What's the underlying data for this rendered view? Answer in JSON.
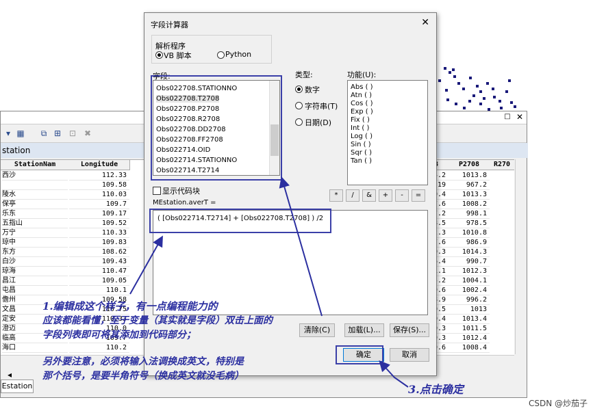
{
  "attr_window": {
    "tab_title": "station",
    "bottom_tab": "Estation",
    "columns": [
      "StationNam",
      "Longitude",
      "8",
      "P2708",
      "R270"
    ],
    "station_names": [
      "西沙",
      "",
      "陵水",
      "保亭",
      "乐东",
      "五指山",
      "万宁",
      "琼中",
      "东方",
      "白沙",
      "琼海",
      "昌江",
      "屯昌",
      "儋州",
      "文昌",
      "定安",
      "澄迈",
      "临高",
      "海口"
    ],
    "longitudes": [
      "112.33",
      "109.58",
      "110.03",
      "109.7",
      "109.17",
      "109.52",
      "110.33",
      "109.83",
      "108.62",
      "109.43",
      "110.47",
      "109.05",
      "110.1",
      "109.58",
      "110.75",
      "110.33",
      "110.0",
      "109.7",
      "110.2"
    ],
    "col8": [
      "4.2",
      "19",
      "0.4",
      "7.6",
      "7.2",
      "8.5",
      "2.3",
      "7.6",
      "0.3",
      "6.4",
      "1.1",
      "5.2",
      "9.6",
      "8.9",
      "0.5",
      "0.4",
      "0.3",
      "9.3",
      "9.6"
    ],
    "p2708": [
      "1013.8",
      "967.2",
      "1013.3",
      "1008.2",
      "998.1",
      "978.5",
      "1010.8",
      "986.9",
      "1014.3",
      "990.7",
      "1012.3",
      "1004.1",
      "1002.4",
      "996.2",
      "1013",
      "1013.4",
      "1011.5",
      "1012.4",
      "1008.4"
    ]
  },
  "dialog": {
    "title": "字段计算器",
    "close_symbol": "✕",
    "parser_label": "解析程序",
    "parser_options": [
      "VB 脚本",
      "Python"
    ],
    "fields_label": "字段:",
    "fields": [
      "Obs022708.STATIONNO",
      "Obs022708.T2708",
      "Obs022708.P2708",
      "Obs022708.R2708",
      "Obs022708.DD2708",
      "Obs022708.FF2708",
      "Obs022714.OID",
      "Obs022714.STATIONNO",
      "Obs022714.T2714"
    ],
    "type_label": "类型:",
    "types": [
      "数字",
      "字符串(T)",
      "日期(D)"
    ],
    "func_label": "功能(U):",
    "functions": [
      "Abs ( )",
      "Atn ( )",
      "Cos ( )",
      "Exp ( )",
      "Fix ( )",
      "Int ( )",
      "Log ( )",
      "Sin ( )",
      "Sqr ( )",
      "Tan ( )"
    ],
    "show_codeblock": "显示代码块",
    "target_label": "MEstation.averT =",
    "operators": [
      "*",
      "/",
      "&",
      "+",
      "-",
      "="
    ],
    "expression": "( [Obs022714.T2714] + [Obs022708.T2708] ) /2",
    "buttons": {
      "clear": "清除(C)",
      "load": "加载(L)...",
      "save": "保存(S)...",
      "ok": "确定",
      "cancel": "取消"
    }
  },
  "annotations": {
    "line1": "1.编辑成这个样子，有一点编程能力的",
    "line2": "应该都能看懂，至于变量（其实就是字段）双击上面的",
    "line3": "字段列表即可将其添加到代码部分；",
    "line4": "另外要注意，必须将输入法调换成英文，特别是",
    "line5": "那个括号，是要半角符号（换成英文就没毛病）",
    "step3": "3.点击确定"
  },
  "watermark": "CSDN @炒茄子"
}
